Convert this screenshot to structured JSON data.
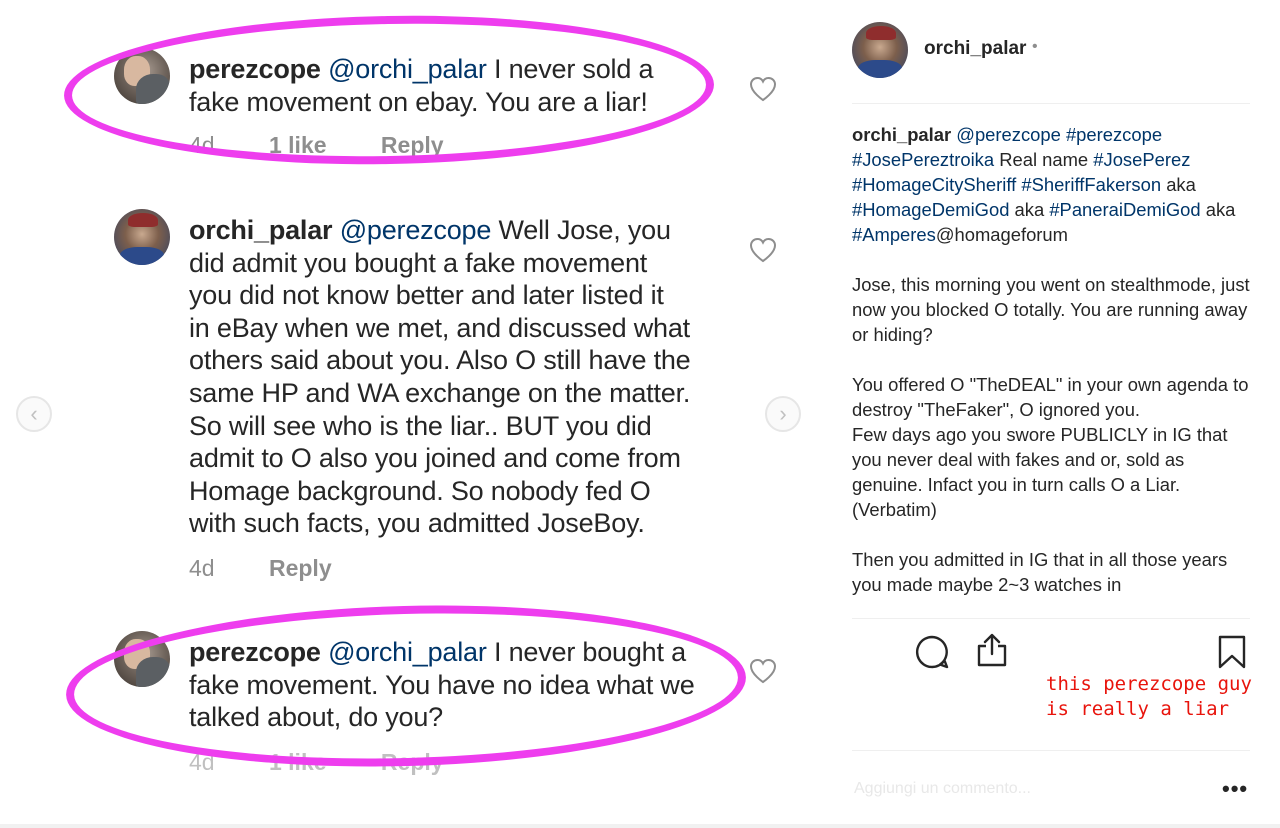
{
  "comments": [
    {
      "user": "perezcope",
      "mention": "@orchi_palar",
      "lines": [
        "I never sold a",
        "fake movement on ebay. You are a liar!"
      ],
      "time": "4d",
      "likes": "1 like",
      "reply": "Reply"
    },
    {
      "user": "orchi_palar",
      "mention": "@perezcope",
      "lines": [
        "Well Jose, you",
        "did admit you bought a fake movement",
        "you did not know better and later listed it",
        "in eBay when we met, and discussed what",
        "others said about you.  Also O still have the",
        "same HP and WA exchange on the matter.",
        "So will see who is the liar.. BUT you did",
        "admit to O also you joined and come from",
        "Homage background.  So nobody fed O",
        "with such facts, you admitted JoseBoy."
      ],
      "time": "4d",
      "reply": "Reply"
    },
    {
      "user": "perezcope",
      "mention": "@orchi_palar",
      "lines": [
        "I never bought a",
        "fake movement. You have no idea what we",
        "talked about, do you?"
      ],
      "time": "4d",
      "likes": "1 like",
      "reply": "Reply"
    }
  ],
  "post": {
    "username": "orchi_palar",
    "dot": "•",
    "caption": {
      "user": "orchi_palar",
      "tags_line1": "@perezcope #perezcope",
      "tag_josepereztroika": "#JosePereztroika",
      "realname_text": "Real name",
      "tag_joseperez": "#JosePerez",
      "tag_homagecitysheriff": "#HomageCitySheriff",
      "tag_sherifffakerson": "#SheriffFakerson",
      "aka1": "aka",
      "tag_homagedemigod": "#HomageDemiGod",
      "aka2": "aka",
      "tag_paneraidemigod": "#PaneraiDemiGod",
      "aka3": "aka",
      "tag_amperes": "#Amperes",
      "forum": "@homageforum",
      "para1": "Jose, this morning you went on stealthmode, just now you blocked O totally. You are running away or hiding?",
      "para2": "You offered O \"TheDEAL\" in your own agenda to destroy \"TheFaker\", O ignored you.",
      "para3": "Few days ago you swore PUBLICLY in IG that you never deal with fakes and or, sold as genuine. Infact you in turn calls O a Liar. (Verbatim)",
      "para4": "Then you admitted in IG that in all those years you made maybe 2~3 watches in"
    },
    "annotation": "this perezcope guy\nis really a liar",
    "add_comment": "Aggiungi un commento...",
    "more": "•••"
  },
  "icons": {
    "heart": "heart-icon",
    "comment": "comment-icon",
    "share": "share-icon",
    "save": "bookmark-icon",
    "prev": "chevron-left-icon",
    "next": "chevron-right-icon"
  },
  "colors": {
    "annotation_circle": "#ee3dee",
    "mention": "#003569",
    "red_note": "#e8140c"
  }
}
